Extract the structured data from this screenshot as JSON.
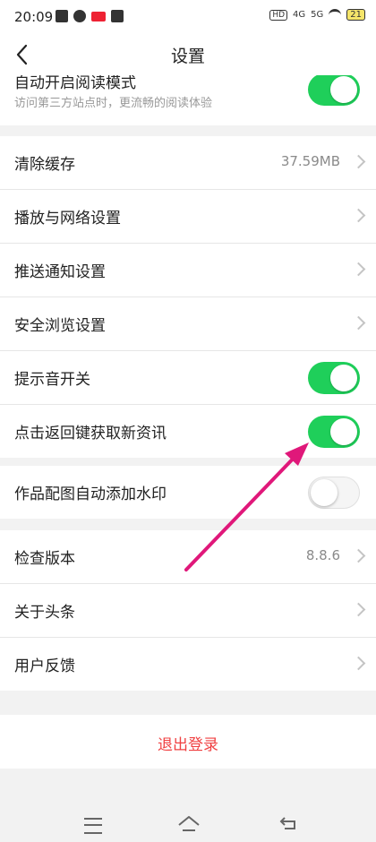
{
  "statusbar": {
    "time": "20:09",
    "net_4g": "4G",
    "net_5g": "5G",
    "hd": "HD",
    "battery": "21"
  },
  "header": {
    "title": "设置"
  },
  "read_mode": {
    "title": "自动开启阅读模式",
    "subtitle": "访问第三方站点时，更流畅的阅读体验",
    "enabled": true
  },
  "group1": [
    {
      "label": "清除缓存",
      "value": "37.59MB"
    },
    {
      "label": "播放与网络设置"
    },
    {
      "label": "推送通知设置"
    },
    {
      "label": "安全浏览设置"
    },
    {
      "label": "提示音开关",
      "enabled": true
    },
    {
      "label": "点击返回键获取新资讯",
      "enabled": true
    }
  ],
  "group2": [
    {
      "label": "作品配图自动添加水印",
      "enabled": false
    }
  ],
  "group3": [
    {
      "label": "检查版本",
      "value": "8.8.6"
    },
    {
      "label": "关于头条"
    },
    {
      "label": "用户反馈"
    }
  ],
  "logout": {
    "label": "退出登录"
  },
  "colors": {
    "accent": "#1fcf5a",
    "danger": "#f04142",
    "annotation_arrow": "#e0187a"
  },
  "icons": [
    "back-icon",
    "chevron-right-icon",
    "menu-icon",
    "home-icon",
    "return-icon",
    "wifi-icon",
    "battery-icon"
  ]
}
